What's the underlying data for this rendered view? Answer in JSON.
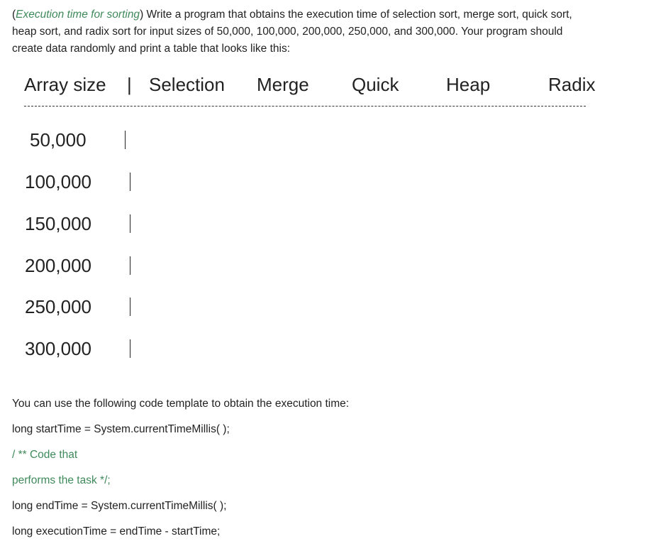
{
  "intro": {
    "emphasis": "Execution time for sorting",
    "open_paren": "(",
    "close_paren": ")",
    "line1": " Write a program that obtains the execution time of selection sort, merge sort, quick sort,",
    "line2": "heap sort, and radix sort for input sizes of 50,000, 100,000, 200,000, 250,000, and 300,000. Your program should",
    "line3": "create data randomly and print a table that looks like this:"
  },
  "table": {
    "headers": [
      "Array size",
      "|",
      "Selection",
      "Merge",
      "Quick",
      "Heap",
      "Radix"
    ],
    "rows": [
      {
        "size": "50,000",
        "sep": "|"
      },
      {
        "size": "100,000",
        "sep": "|"
      },
      {
        "size": "150,000",
        "sep": "|"
      },
      {
        "size": "200,000",
        "sep": "|"
      },
      {
        "size": "250,000",
        "sep": "|"
      },
      {
        "size": "300,000",
        "sep": "|"
      }
    ]
  },
  "template": {
    "intro": "You can use the following code template to obtain the execution time:",
    "lines": [
      "long startTime = System.currentTimeMillis( );",
      "/ ** Code that",
      "performs the task */;",
      "long endTime = System.currentTimeMillis( );",
      "long executionTime = endTime - startTime;"
    ]
  },
  "colors": {
    "text": "#222222",
    "accent_green": "#3f8a5b"
  }
}
